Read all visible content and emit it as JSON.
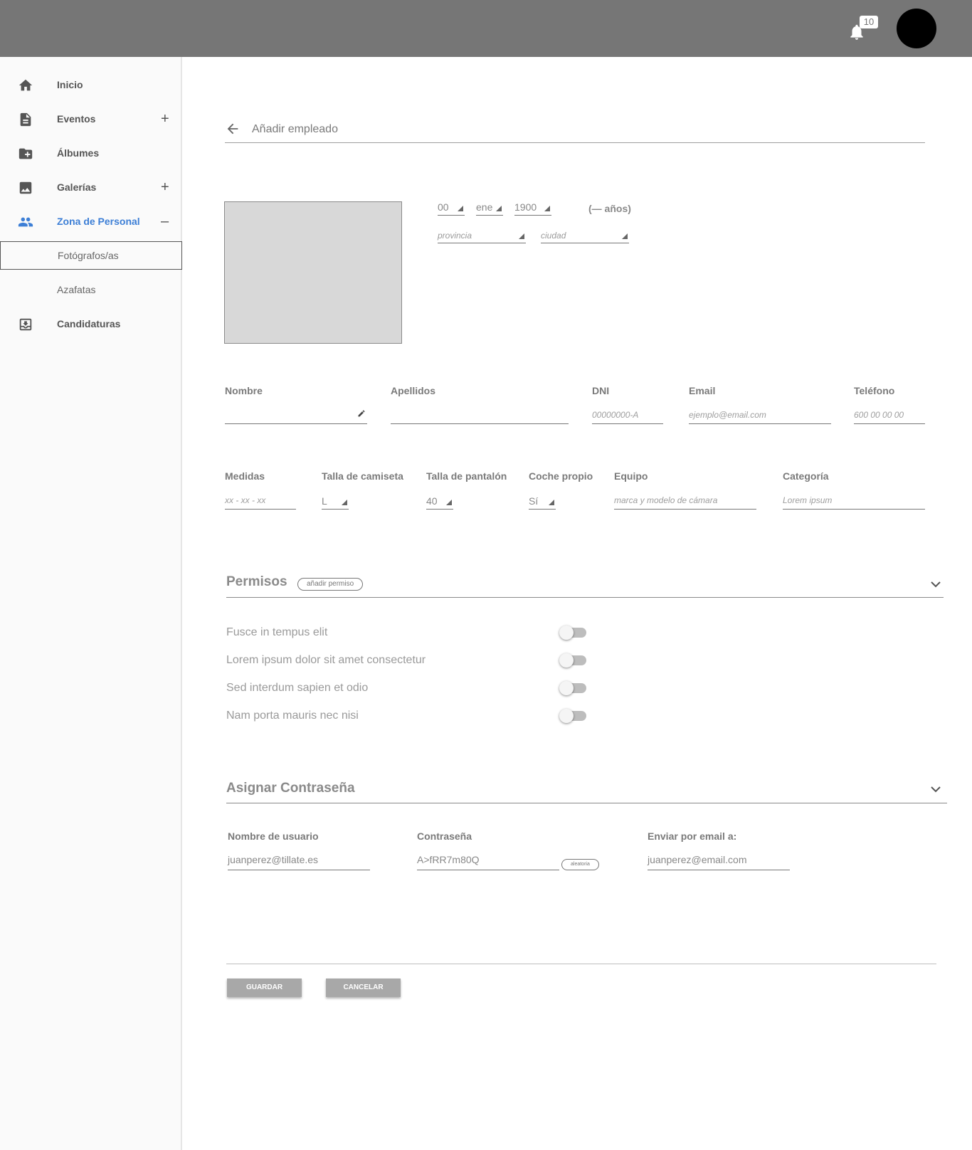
{
  "topbar": {
    "notifications_count": "10"
  },
  "sidebar": {
    "items": [
      {
        "label": "Inicio",
        "icon": "home-icon"
      },
      {
        "label": "Eventos",
        "icon": "document-icon",
        "toggle": "+"
      },
      {
        "label": "Álbumes",
        "icon": "folder-add-icon"
      },
      {
        "label": "Galerías",
        "icon": "image-icon",
        "toggle": "+"
      },
      {
        "label": "Zona de Personal",
        "icon": "people-icon",
        "toggle": "–",
        "active": true
      },
      {
        "label": "Fotógrafos/as",
        "sub": true,
        "selected": true
      },
      {
        "label": "Azafatas",
        "sub": true
      },
      {
        "label": "Candidaturas",
        "icon": "inbox-download-icon"
      }
    ],
    "active_color": "#3d7fd6"
  },
  "page": {
    "title": "Añadir empleado"
  },
  "birth": {
    "day": "00",
    "month": "ene",
    "year": "1900",
    "age": "(— años)",
    "province_placeholder": "provincia",
    "city_placeholder": "ciudad"
  },
  "fields_row1": {
    "nombre": {
      "label": "Nombre",
      "value": ""
    },
    "apellidos": {
      "label": "Apellidos",
      "value": ""
    },
    "dni": {
      "label": "DNI",
      "placeholder": "00000000-A"
    },
    "email": {
      "label": "Email",
      "placeholder": "ejemplo@email.com"
    },
    "telefono": {
      "label": "Teléfono",
      "placeholder": "600 00 00 00"
    }
  },
  "fields_row2": {
    "medidas": {
      "label": "Medidas",
      "placeholder": "xx - xx - xx"
    },
    "camiseta": {
      "label": "Talla de camiseta",
      "value": "L"
    },
    "pantalon": {
      "label": "Talla de pantalón",
      "value": "40"
    },
    "coche": {
      "label": "Coche propio",
      "value": "Sí"
    },
    "equipo": {
      "label": "Equipo",
      "placeholder": "marca y modelo de cámara"
    },
    "categoria": {
      "label": "Categoría",
      "placeholder": "Lorem ipsum"
    }
  },
  "permisos": {
    "title": "Permisos",
    "add_button": "añadir permiso",
    "items": [
      {
        "label": "Fusce in tempus elit",
        "enabled": false
      },
      {
        "label": "Lorem ipsum dolor sit amet consectetur",
        "enabled": false
      },
      {
        "label": "Sed interdum sapien et odio",
        "enabled": false
      },
      {
        "label": "Nam porta mauris nec nisi",
        "enabled": false
      }
    ]
  },
  "password": {
    "title": "Asignar Contraseña",
    "username": {
      "label": "Nombre de usuario",
      "value": "juanperez@tillate.es"
    },
    "password": {
      "label": "Contraseña",
      "value": "A>fRR7m80Q"
    },
    "random_button": "aleatoria",
    "send_email": {
      "label": "Enviar por email a:",
      "value": "juanperez@email.com"
    }
  },
  "actions": {
    "save": "GUARDAR",
    "cancel": "CANCELAR"
  }
}
